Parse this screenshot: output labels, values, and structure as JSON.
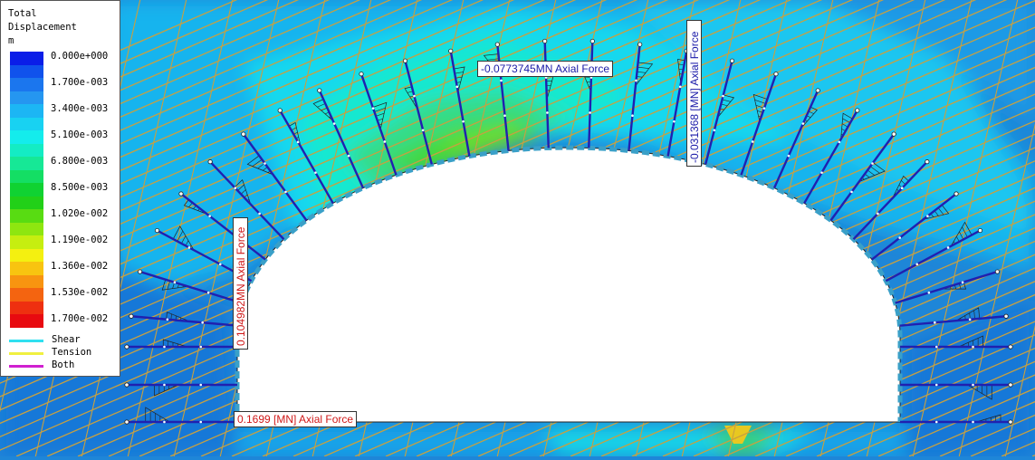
{
  "legend": {
    "title_lines": [
      "Total",
      "Displacement",
      "m"
    ],
    "stops": [
      {
        "label": "0.000e+000",
        "color": "#0a1ee8"
      },
      {
        "label": "",
        "color": "#1052ec"
      },
      {
        "label": "1.700e-003",
        "color": "#1b76ee"
      },
      {
        "label": "",
        "color": "#2596f0"
      },
      {
        "label": "3.400e-003",
        "color": "#1cb6f4"
      },
      {
        "label": "",
        "color": "#18d2f2"
      },
      {
        "label": "5.100e-003",
        "color": "#14ecec"
      },
      {
        "label": "",
        "color": "#14ecc4"
      },
      {
        "label": "6.800e-003",
        "color": "#16e896"
      },
      {
        "label": "",
        "color": "#14de64"
      },
      {
        "label": "8.500e-003",
        "color": "#10d232"
      },
      {
        "label": "",
        "color": "#22d018"
      },
      {
        "label": "1.020e-002",
        "color": "#58dc12"
      },
      {
        "label": "",
        "color": "#8ee610"
      },
      {
        "label": "1.190e-002",
        "color": "#c6ee10"
      },
      {
        "label": "",
        "color": "#f4f010"
      },
      {
        "label": "1.360e-002",
        "color": "#f8c410"
      },
      {
        "label": "",
        "color": "#f89410"
      },
      {
        "label": "1.530e-002",
        "color": "#f46410"
      },
      {
        "label": "",
        "color": "#ee3010"
      },
      {
        "label": "1.700e-002",
        "color": "#e80a10"
      }
    ],
    "line_legend": [
      {
        "label": "Shear",
        "color": "#30e0f0"
      },
      {
        "label": "Tension",
        "color": "#f0f040"
      },
      {
        "label": "Both",
        "color": "#d020d0"
      }
    ]
  },
  "annotations": {
    "crown": "-0.0773745MN Axial Force",
    "right_shoulder": "-0.031368 [MN] Axial Force",
    "left_wall": "0.104982MN Axial Force",
    "invert": "0.1699 [MN] Axial Force"
  },
  "colors": {
    "background": "#1e86d8",
    "bolt": "#2020b0",
    "liner": "#3aa0c8",
    "joint": "#c8a040",
    "excavation": "#ffffff"
  }
}
